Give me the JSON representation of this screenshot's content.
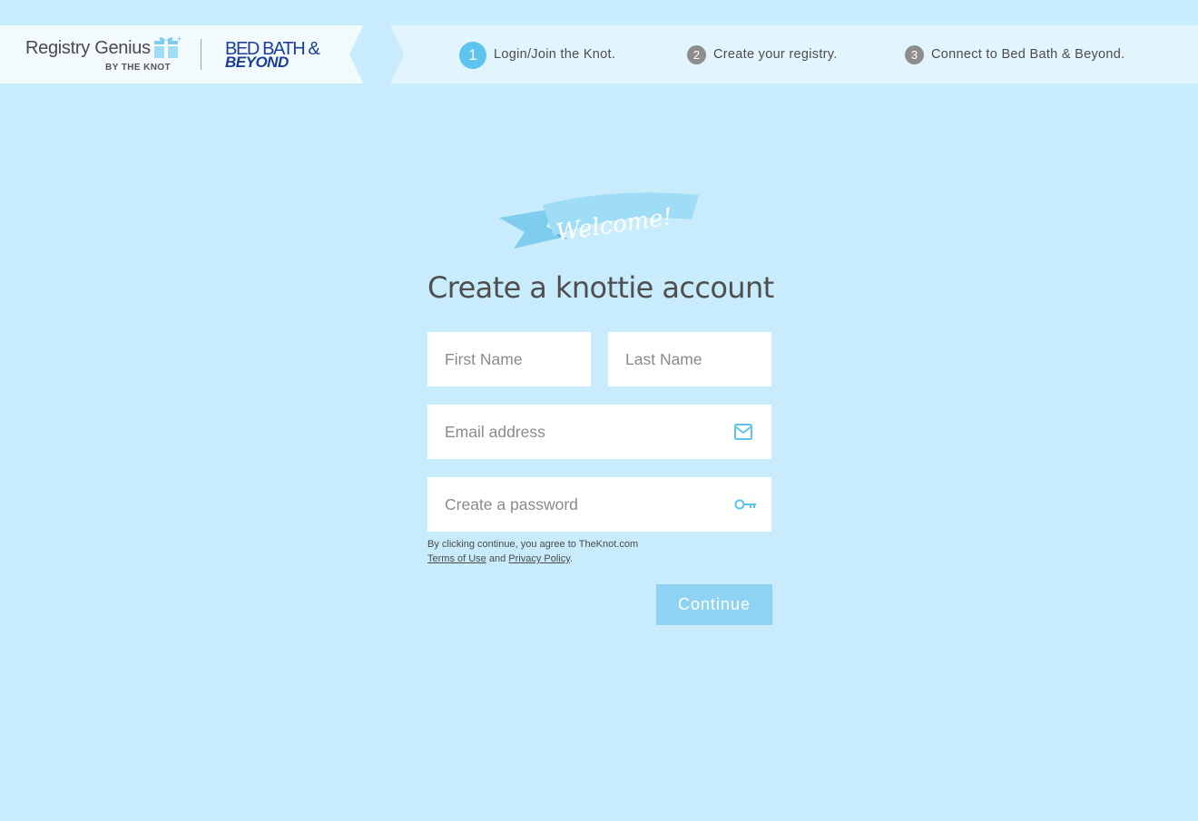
{
  "header": {
    "brand": {
      "registry_title": "Registry Genius",
      "registry_subtitle": "BY THE KNOT",
      "partner_line1": "BED BATH &",
      "partner_line2": "BEYOND"
    },
    "steps": [
      {
        "number": "1",
        "label": "Login/Join the Knot.",
        "active": true
      },
      {
        "number": "2",
        "label": "Create your registry.",
        "active": false
      },
      {
        "number": "3",
        "label": "Connect to Bed Bath & Beyond.",
        "active": false
      }
    ]
  },
  "main": {
    "welcome": "Welcome!",
    "title": "Create a knottie account",
    "fields": {
      "first_name": {
        "placeholder": "First Name",
        "value": ""
      },
      "last_name": {
        "placeholder": "Last Name",
        "value": ""
      },
      "email": {
        "placeholder": "Email address",
        "value": "",
        "icon": "mail-icon"
      },
      "password": {
        "placeholder": "Create a password",
        "value": "",
        "icon": "key-icon"
      }
    },
    "legal": {
      "prefix": "By clicking continue, you agree to TheKnot.com",
      "terms_link": "Terms of Use",
      "conjunction": "and",
      "privacy_link": "Privacy Policy",
      "suffix": "."
    },
    "continue_label": "Continue"
  },
  "colors": {
    "page_background": "#c8ecfc",
    "accent_active_step": "#5ec4ee",
    "inactive_step": "#8d8d8d",
    "button": "#8fd3f2",
    "partner_brand": "#1c3d94"
  }
}
